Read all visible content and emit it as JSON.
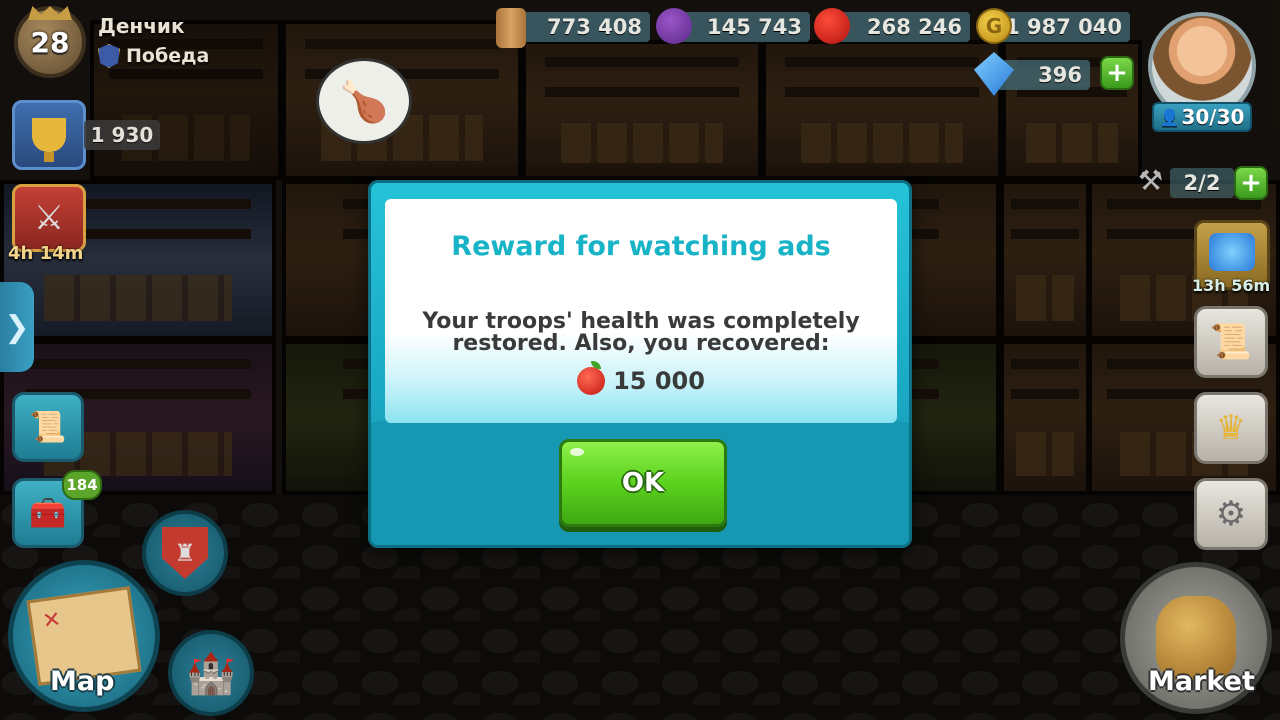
{
  "player": {
    "level": "28",
    "name": "Денчик",
    "status": "Победа"
  },
  "trophies": "1 930",
  "battle_timer": "4h 14m",
  "resources": {
    "wood": "773 408",
    "grapes": "145 743",
    "apples": "268 246",
    "gold": "1 987 040",
    "gems": "396"
  },
  "population": "30/30",
  "builders": "2/2",
  "gem_mine_timer": "13h 56m",
  "chest_badge": "184",
  "nav": {
    "map_label": "Map",
    "market_label": "Market"
  },
  "modal": {
    "title": "Reward for watching ads",
    "line1": "Your troops' health was completely",
    "line2": "restored. Also, you recovered:",
    "reward_amount": "15 000",
    "ok_label": "OK"
  },
  "colors": {
    "modal_frame": "#1aa8c2",
    "title": "#17b3c7",
    "ok_button": "#5cd21e"
  },
  "icons": {
    "gold_symbol": "G",
    "arrow": "❯",
    "plus": "+",
    "person": "👤"
  }
}
